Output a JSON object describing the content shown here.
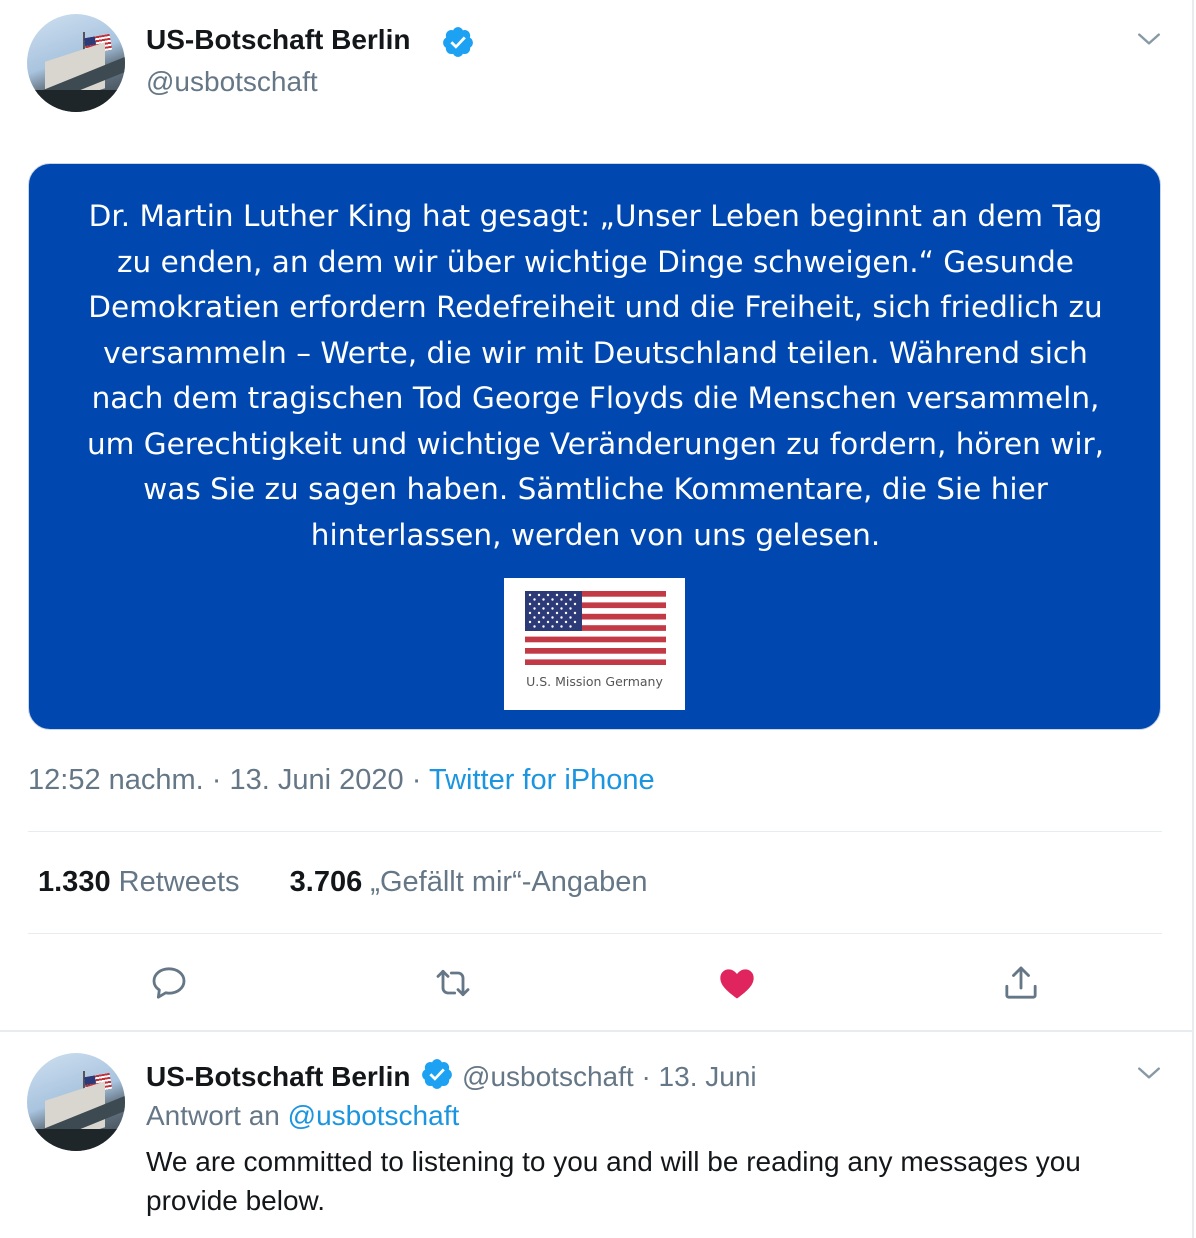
{
  "tweet": {
    "display_name": "US-Botschaft Berlin",
    "handle": "@usbotschaft",
    "media": {
      "text": "Dr. Martin Luther King hat gesagt: „Unser Leben beginnt an dem Tag zu enden, an dem wir über wichtige Dinge schweigen.“ Gesunde Demokratien erfordern Redefreiheit und die Freiheit, sich friedlich zu versammeln – Werte, die wir mit Deutschland teilen. Während sich nach dem tragischen Tod George Floyds die Menschen versammeln, um Gerechtigkeit und wichtige Veränderungen zu fordern, hören wir, was Sie zu sagen haben. Sämtliche Kommentare, die Sie hier hinterlassen, werden von uns gelesen.",
      "logo_caption": "U.S. Mission Germany",
      "background_color": "#0047b0"
    },
    "time": "12:52 nachm.",
    "date": "13. Juni 2020",
    "separator": "·",
    "source": "Twitter for iPhone",
    "retweets_count": "1.330",
    "retweets_label": "Retweets",
    "likes_count": "3.706",
    "likes_label": "„Gefällt mir“-Angaben",
    "actions": {
      "reply_icon": "speech-bubble-icon",
      "retweet_icon": "retweet-arrows-icon",
      "like_icon": "heart-icon",
      "like_color": "#e0245e",
      "share_icon": "share-upload-icon"
    }
  },
  "reply": {
    "display_name": "US-Botschaft Berlin",
    "handle": "@usbotschaft",
    "separator": "·",
    "date": "13. Juni",
    "reply_to_label": "Antwort an",
    "reply_to_handle": "@usbotschaft",
    "text": "We are committed to listening to you and will be reading any messages you provide below."
  },
  "colors": {
    "accent": "#1b95e0",
    "verified": "#1da1f2",
    "secondary_text": "#657786"
  }
}
